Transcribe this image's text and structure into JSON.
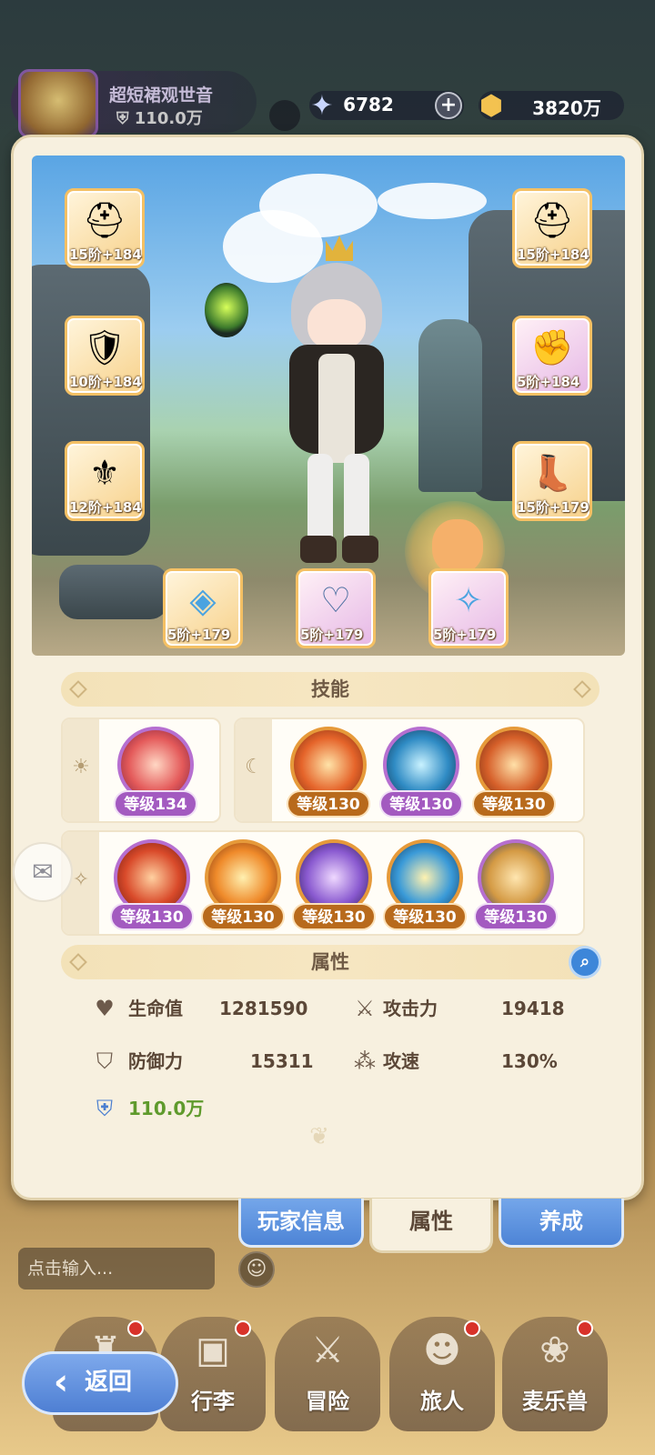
{
  "player": {
    "name": "超短裙观世音",
    "power": "110.0万"
  },
  "currency": {
    "gems": "6782",
    "gold": "3820万",
    "gem_icon": "star-crystal-icon",
    "gold_icon": "gold-coin-icon",
    "plus": "+"
  },
  "equipment": {
    "left": [
      {
        "name": "helmet",
        "label": "15阶+184"
      },
      {
        "name": "armor",
        "label": "10阶+184"
      },
      {
        "name": "belt",
        "label": "12阶+184"
      }
    ],
    "right": [
      {
        "name": "headgear",
        "label": "15阶+184"
      },
      {
        "name": "gloves",
        "label": "5阶+184"
      },
      {
        "name": "boots",
        "label": "15阶+179"
      }
    ],
    "bottom": [
      {
        "name": "ring",
        "label": "5阶+179"
      },
      {
        "name": "necklace",
        "label": "5阶+179"
      },
      {
        "name": "amulet",
        "label": "5阶+179"
      }
    ]
  },
  "skills": {
    "title": "技能",
    "sun_group": [
      {
        "level": "等级134",
        "style": "purple"
      }
    ],
    "moon_group": [
      {
        "level": "等级130",
        "style": "gold"
      },
      {
        "level": "等级130",
        "style": "purple"
      },
      {
        "level": "等级130",
        "style": "gold"
      }
    ],
    "star_group": [
      {
        "level": "等级130",
        "style": "purple"
      },
      {
        "level": "等级130",
        "style": "gold"
      },
      {
        "level": "等级130",
        "style": "gold"
      },
      {
        "level": "等级130",
        "style": "gold"
      },
      {
        "level": "等级130",
        "style": "purple"
      }
    ]
  },
  "attributes": {
    "title": "属性",
    "hp_label": "生命值",
    "hp_value": "1281590",
    "atk_label": "攻击力",
    "atk_value": "19418",
    "def_label": "防御力",
    "def_value": "15311",
    "spd_label": "攻速",
    "spd_value": "130%",
    "power": "110.0万"
  },
  "tabs": {
    "player_info": "玩家信息",
    "attributes": "属性",
    "develop": "养成"
  },
  "chat": {
    "placeholder": "点击输入..."
  },
  "nav": {
    "back": "返回",
    "bag": "行李",
    "adventure": "冒险",
    "traveler": "旅人",
    "pets": "麦乐兽"
  },
  "colors": {
    "accent_blue": "#4d84d6",
    "panel_bg": "#f7f0df",
    "power_green": "#5f9a2c",
    "skill_purple": "#a35ac0",
    "skill_gold": "#b86a1c"
  }
}
